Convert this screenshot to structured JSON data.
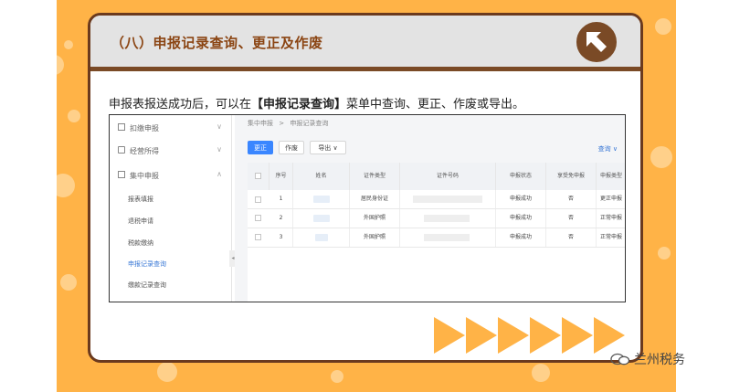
{
  "card": {
    "title": "（八）申报记录查询、更正及作废",
    "intro_before": "申报表报送成功后，可以在",
    "intro_bold": "【申报记录查询】",
    "intro_after": "菜单中查询、更正、作废或导出。"
  },
  "screenshot": {
    "sidebar": {
      "items": [
        {
          "label": "扣缴申报",
          "icon": "doc-icon"
        },
        {
          "label": "经营所得",
          "icon": "plus-square-icon"
        },
        {
          "label": "集中申报",
          "icon": "collapse-icon"
        }
      ],
      "sub_items": [
        {
          "label": "报表填报"
        },
        {
          "label": "退税申请"
        },
        {
          "label": "税款缴纳"
        },
        {
          "label": "申报记录查询"
        },
        {
          "label": "缴款记录查询"
        }
      ]
    },
    "breadcrumb": {
      "root": "集中申报",
      "separator": ">",
      "current": "申报记录查询"
    },
    "toolbar": {
      "correct": "更正",
      "void": "作废",
      "export": "导出 ∨",
      "query": "查询 ∨"
    },
    "table": {
      "headers": [
        "序号",
        "姓名",
        "证件类型",
        "证件号码",
        "申报状态",
        "享受免申报",
        "申报类型"
      ],
      "rows": [
        {
          "no": "1",
          "id_type": "居民身份证",
          "status": "申报成功",
          "exempt": "否",
          "type": "更正申报"
        },
        {
          "no": "2",
          "id_type": "外国护照",
          "status": "申报成功",
          "exempt": "否",
          "type": "正常申报"
        },
        {
          "no": "3",
          "id_type": "外国护照",
          "status": "申报成功",
          "exempt": "否",
          "type": "正常申报"
        }
      ]
    }
  },
  "watermark": {
    "text": "兰州税务"
  },
  "colors": {
    "background": "#ffb347",
    "card_border": "#6b3a1e",
    "title": "#8b4513",
    "accent_blue": "#3a86ff"
  }
}
